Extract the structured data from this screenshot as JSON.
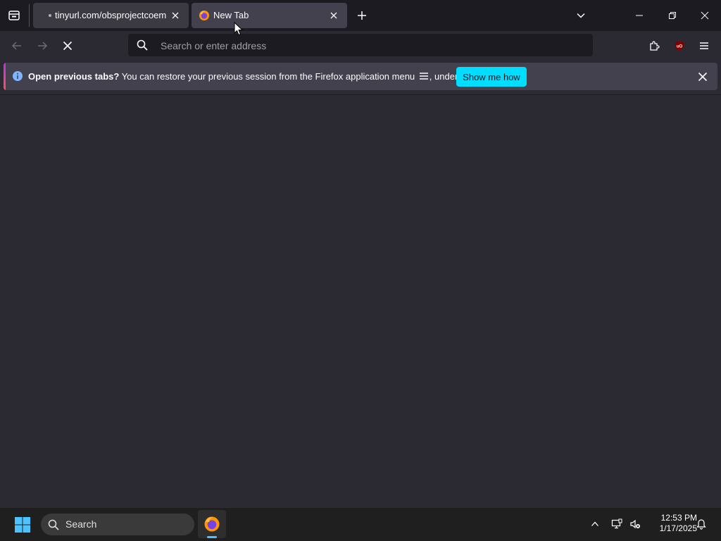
{
  "browser": {
    "tabs": [
      {
        "label": "tinyurl.com/obsprojectcoems",
        "active": false,
        "loading_dot": true
      },
      {
        "label": "New Tab",
        "active": true
      }
    ],
    "urlbar": {
      "placeholder": "Search or enter address",
      "value": ""
    },
    "notification": {
      "bold_text": "Open previous tabs?",
      "text_before_menu": "You can restore your previous session from the Firefox application menu",
      "text_after_menu": ", under History.",
      "button_label": "Show me how"
    },
    "icons": {
      "firefox_view": "firefox-view-icon",
      "back": "back-arrow-icon",
      "forward": "forward-arrow-icon",
      "stop": "stop-icon",
      "search": "search-icon",
      "extensions": "extensions-icon",
      "ublock": "ublock-origin-icon",
      "menu": "hamburger-menu-icon"
    }
  },
  "taskbar": {
    "search_label": "Search",
    "time": "12:53 PM",
    "date": "1/17/2025"
  },
  "colors": {
    "accent": "#00ddff",
    "toolbar": "#2b2a33",
    "tabstrip": "#1c1b22",
    "notification": "#42414d"
  }
}
